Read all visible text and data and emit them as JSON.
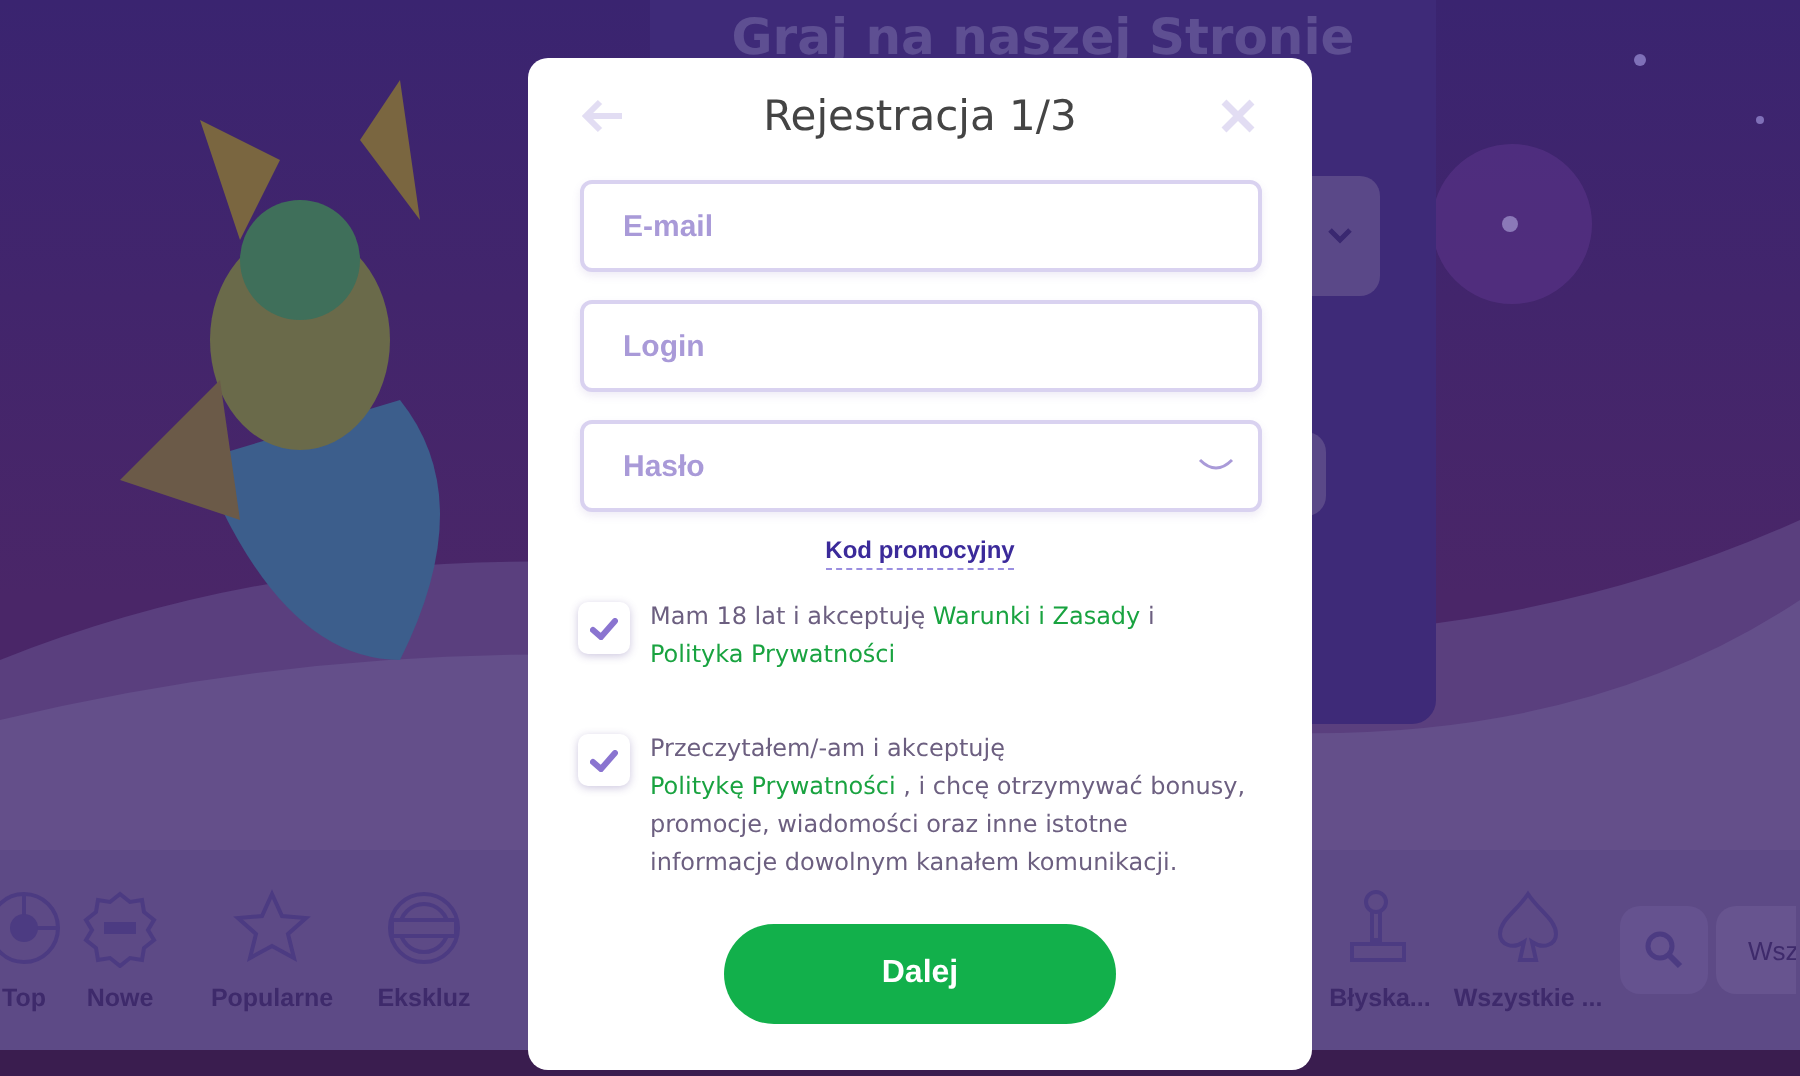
{
  "hero": {
    "kind": "picture",
    "panel": {
      "title": "Graj na naszej Stronie"
    }
  },
  "categories": [
    {
      "label": "Top"
    },
    {
      "label": "Nowe"
    },
    {
      "label": "Popularne"
    },
    {
      "label": "Ekskluz"
    },
    {
      "label": "Błyska..."
    },
    {
      "label": "Wszystkie ..."
    }
  ],
  "search_field": {
    "placeholder": "Wsz"
  },
  "modal": {
    "title": "Rejestracja 1/3",
    "fields": [
      {
        "placeholder": "E-mail",
        "kind": "text"
      },
      {
        "placeholder": "Login",
        "kind": "text"
      },
      {
        "placeholder": "Hasło",
        "kind": "password"
      }
    ],
    "promo_link": "Kod promocyjny",
    "consents": [
      {
        "checked": true,
        "parts": [
          {
            "text": "Mam 18 lat i akceptuję ",
            "link": false
          },
          {
            "text": "Warunki i Zasady",
            "link": true
          },
          {
            "text": " i ",
            "link": false
          },
          {
            "text": "Polityka Prywatności",
            "link": true
          }
        ]
      },
      {
        "checked": true,
        "parts": [
          {
            "text": "Przeczytałem/-am i akceptuję ",
            "link": false
          },
          {
            "text": "Politykę Prywatności",
            "link": true
          },
          {
            "text": " , i chcę otrzymywać bonusy, promocje, wiadomości oraz inne istotne informacje dowolnym kanałem komunikacji.",
            "link": false
          }
        ]
      }
    ],
    "submit": "Dalej"
  }
}
